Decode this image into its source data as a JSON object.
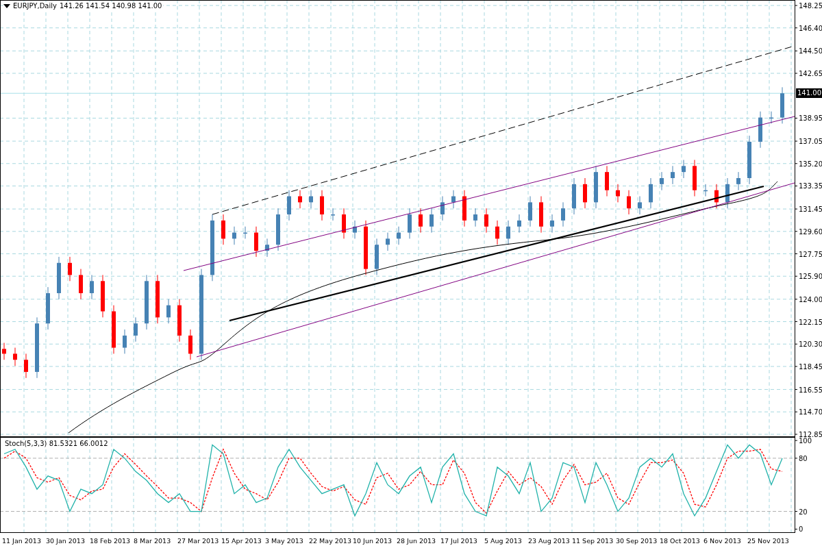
{
  "chart_header": {
    "symbol": "EURJPY,Daily",
    "ohlc": "141.26 141.54 140.98 141.00"
  },
  "price_panel": {
    "current_price_label": "141.00",
    "chart_data": {
      "type": "candlestick",
      "grid": true,
      "ylim": [
        112.85,
        148.25
      ],
      "yticks": [
        {
          "value": 148.25,
          "label": "148.25"
        },
        {
          "value": 146.4,
          "label": "146.40"
        },
        {
          "value": 144.5,
          "label": "144.50"
        },
        {
          "value": 142.65,
          "label": "142.65"
        },
        {
          "value": 138.95,
          "label": "138.95"
        },
        {
          "value": 137.05,
          "label": "137.05"
        },
        {
          "value": 135.2,
          "label": "135.20"
        },
        {
          "value": 133.35,
          "label": "133.35"
        },
        {
          "value": 131.45,
          "label": "131.45"
        },
        {
          "value": 129.6,
          "label": "129.60"
        },
        {
          "value": 127.75,
          "label": "127.75"
        },
        {
          "value": 125.9,
          "label": "125.90"
        },
        {
          "value": 124,
          "label": "124.00"
        },
        {
          "value": 122.15,
          "label": "122.15"
        },
        {
          "value": 120.3,
          "label": "120.30"
        },
        {
          "value": 118.45,
          "label": "118.45"
        },
        {
          "value": 116.55,
          "label": "116.55"
        },
        {
          "value": 114.7,
          "label": "114.70"
        },
        {
          "value": 112.85,
          "label": "112.85"
        }
      ],
      "ref_lines": [
        {
          "axis": "y",
          "value": 141
        }
      ],
      "ohlc": [
        [
          119.9,
          120.4,
          119,
          119.5
        ],
        [
          119.5,
          120,
          118.5,
          119
        ],
        [
          119,
          119.5,
          117.5,
          118
        ],
        [
          118,
          122.5,
          117.5,
          122
        ],
        [
          122,
          125,
          121.5,
          124.5
        ],
        [
          124.5,
          127.5,
          124,
          127
        ],
        [
          127,
          127.5,
          125.5,
          126
        ],
        [
          126,
          126.5,
          124,
          124.5
        ],
        [
          124.5,
          126,
          124,
          125.5
        ],
        [
          125.5,
          126,
          122.5,
          123
        ],
        [
          123,
          123.5,
          119.5,
          120
        ],
        [
          120,
          121.5,
          119.5,
          121
        ],
        [
          121,
          122.5,
          120.5,
          122
        ],
        [
          122,
          126,
          121.5,
          125.5
        ],
        [
          125.5,
          126,
          122,
          122.5
        ],
        [
          122.5,
          124,
          122,
          123.5
        ],
        [
          123.5,
          124,
          120.5,
          121
        ],
        [
          121,
          121.5,
          119,
          119.5
        ],
        [
          119.5,
          126.5,
          119,
          126
        ],
        [
          126,
          131,
          125.5,
          130.5
        ],
        [
          130.5,
          131,
          128.5,
          129
        ],
        [
          129,
          130,
          128.5,
          129.5
        ],
        [
          129.5,
          130,
          129,
          129.5
        ],
        [
          129.5,
          130,
          127.5,
          128
        ],
        [
          128,
          129,
          127.5,
          128.5
        ],
        [
          128.5,
          131.5,
          128,
          131
        ],
        [
          131,
          133,
          130.5,
          132.5
        ],
        [
          132.5,
          133,
          131.5,
          132
        ],
        [
          132,
          133,
          131.5,
          132.5
        ],
        [
          132.5,
          133,
          130.5,
          131
        ],
        [
          131,
          131.5,
          130.5,
          131
        ],
        [
          131,
          131.5,
          129,
          129.5
        ],
        [
          129.5,
          130.5,
          129,
          130
        ],
        [
          130,
          130.5,
          126,
          126.5
        ],
        [
          126.5,
          129,
          126,
          128.5
        ],
        [
          128.5,
          129.5,
          128,
          129
        ],
        [
          129,
          130,
          128.5,
          129.5
        ],
        [
          129.5,
          131.5,
          129,
          131
        ],
        [
          131,
          131.5,
          129.5,
          130
        ],
        [
          130,
          131.5,
          129.5,
          131
        ],
        [
          131,
          132.5,
          130.5,
          132
        ],
        [
          132,
          133,
          131.5,
          132.5
        ],
        [
          132.5,
          133,
          130,
          130.5
        ],
        [
          130.5,
          131.5,
          130,
          131
        ],
        [
          131,
          131.5,
          129.5,
          130
        ],
        [
          130,
          130.5,
          128.5,
          129
        ],
        [
          129,
          130.5,
          128.5,
          130
        ],
        [
          130,
          131,
          129.5,
          130.5
        ],
        [
          130.5,
          132.5,
          130,
          132
        ],
        [
          132,
          132.5,
          129.5,
          130
        ],
        [
          130,
          131,
          129.5,
          130.5
        ],
        [
          130.5,
          132,
          130,
          131.5
        ],
        [
          131.5,
          134,
          131,
          133.5
        ],
        [
          133.5,
          134,
          131.5,
          132
        ],
        [
          132,
          135,
          131.5,
          134.5
        ],
        [
          134.5,
          135,
          132.5,
          133
        ],
        [
          133,
          133.5,
          132,
          132.5
        ],
        [
          132.5,
          133,
          131,
          131.5
        ],
        [
          131.5,
          132.5,
          131,
          132
        ],
        [
          132,
          134,
          131.5,
          133.5
        ],
        [
          133.5,
          134.5,
          133,
          134
        ],
        [
          134,
          135,
          133.5,
          134.5
        ],
        [
          134.5,
          135.5,
          134,
          135
        ],
        [
          135,
          135.5,
          132.5,
          133
        ],
        [
          133,
          133.5,
          132.5,
          133
        ],
        [
          133,
          133.5,
          131.5,
          132
        ],
        [
          132,
          134,
          131.5,
          133.5
        ],
        [
          133.5,
          134.5,
          133,
          134
        ],
        [
          134,
          137.5,
          133.5,
          137
        ],
        [
          137,
          139.5,
          136.5,
          139
        ],
        [
          139,
          139.5,
          138.5,
          139
        ],
        [
          139,
          141.5,
          138.5,
          141
        ]
      ]
    }
  },
  "stochastic_panel": {
    "label": "Stoch(5,3,3) 81.5321 66.0012",
    "chart_data": {
      "type": "line",
      "grid": true,
      "ylim": [
        -4.3,
        103.9
      ],
      "yticks": [
        0,
        20,
        80,
        100
      ],
      "series": [
        {
          "color": "#20b2aa",
          "values": [
            85,
            90,
            70,
            45,
            60,
            55,
            20,
            45,
            40,
            50,
            90,
            80,
            65,
            55,
            40,
            30,
            40,
            20,
            20,
            95,
            85,
            40,
            50,
            30,
            35,
            70,
            90,
            70,
            55,
            40,
            45,
            50,
            15,
            40,
            75,
            50,
            40,
            60,
            70,
            30,
            70,
            85,
            40,
            20,
            15,
            70,
            60,
            40,
            75,
            20,
            35,
            75,
            70,
            30,
            75,
            50,
            20,
            35,
            70,
            80,
            70,
            85,
            40,
            15,
            35,
            65,
            95,
            80,
            95,
            85,
            50,
            80
          ]
        },
        {
          "color": "#ff0000",
          "line_style": "dotted",
          "values": [
            80,
            88,
            80,
            58,
            53,
            58,
            38,
            33,
            43,
            45,
            70,
            85,
            73,
            60,
            48,
            35,
            35,
            30,
            20,
            58,
            90,
            63,
            45,
            40,
            33,
            53,
            80,
            80,
            63,
            48,
            43,
            48,
            33,
            28,
            58,
            63,
            45,
            50,
            65,
            50,
            50,
            78,
            63,
            30,
            18,
            43,
            65,
            50,
            58,
            48,
            28,
            55,
            73,
            50,
            53,
            63,
            35,
            28,
            53,
            75,
            75,
            78,
            63,
            28,
            25,
            50,
            80,
            88,
            88,
            90,
            68,
            65
          ]
        }
      ]
    }
  },
  "time_axis": [
    "11 Jan 2013",
    "30 Jan 2013",
    "18 Feb 2013",
    "8 Mar 2013",
    "27 Mar 2013",
    "15 Apr 2013",
    "3 May 2013",
    "22 May 2013",
    "10 Jun 2013",
    "28 Jun 2013",
    "17 Jul 2013",
    "5 Aug 2013",
    "23 Aug 2013",
    "11 Sep 2013",
    "30 Sep 2013",
    "18 Oct 2013",
    "6 Nov 2013",
    "25 Nov 2013"
  ]
}
